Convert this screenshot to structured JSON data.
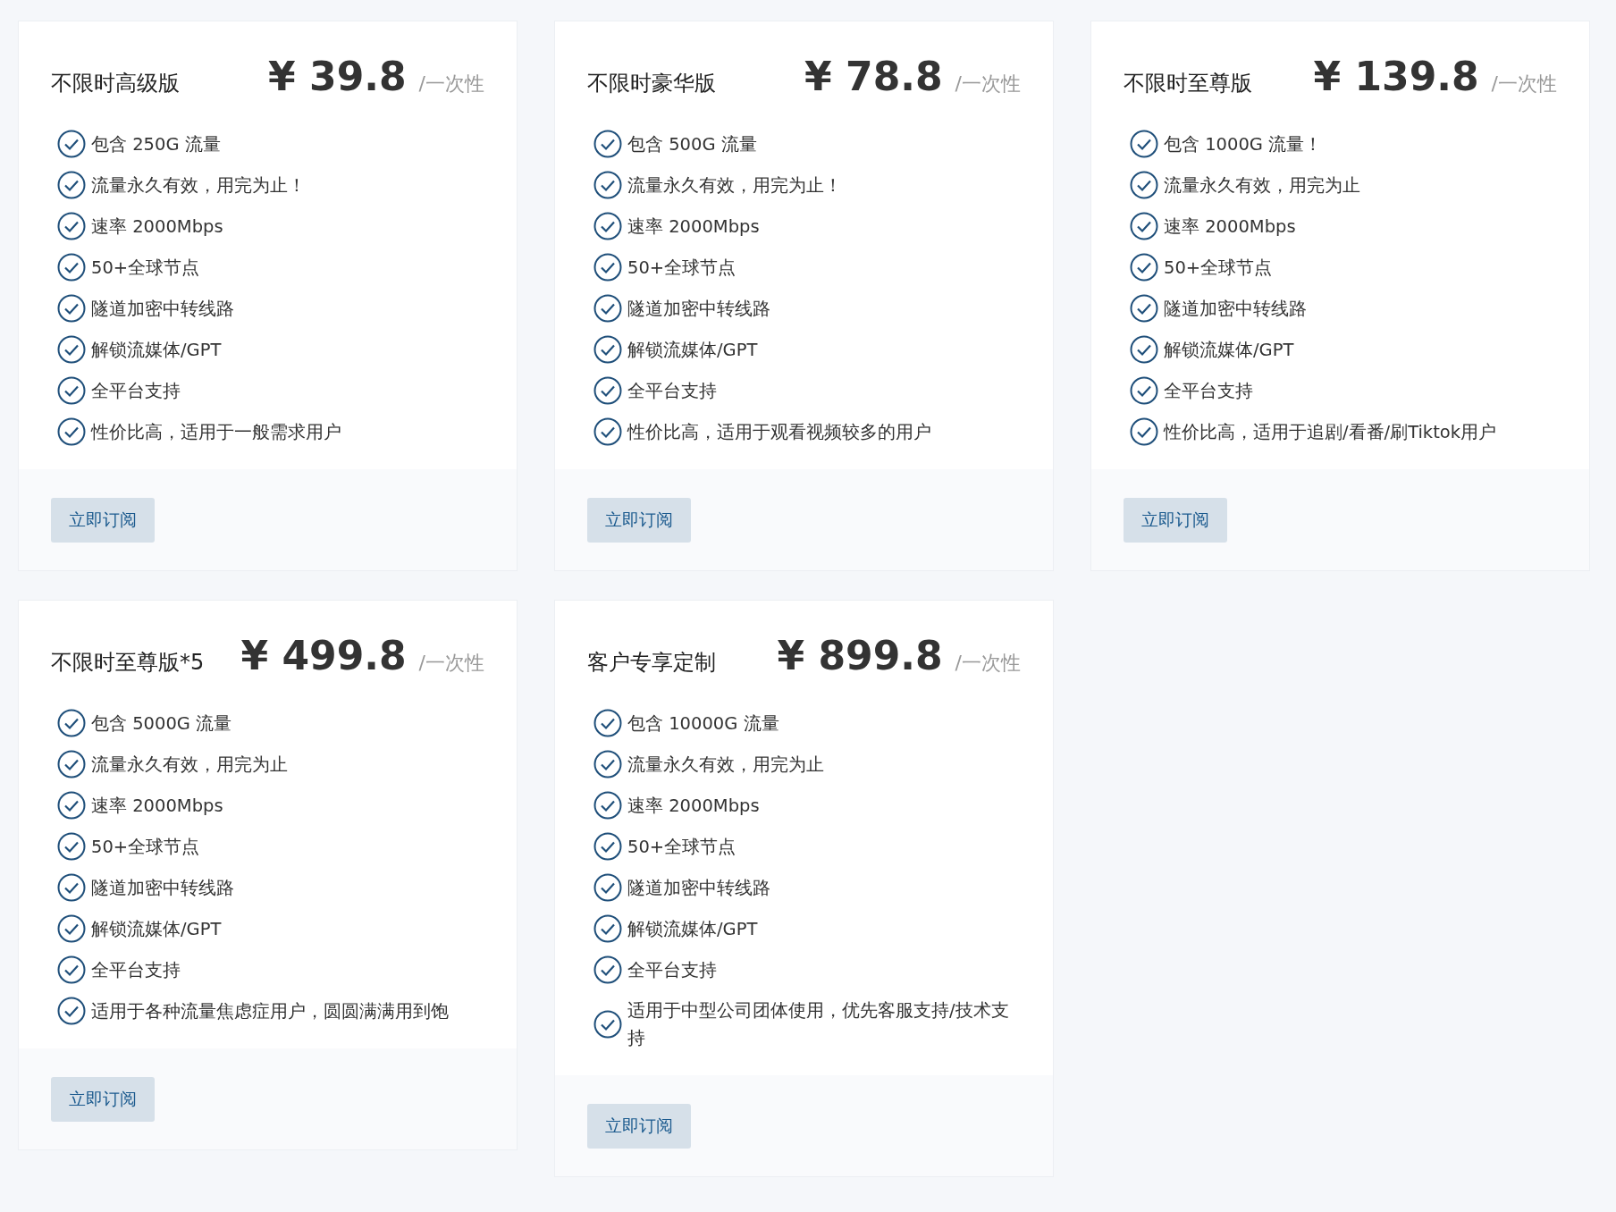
{
  "plans": [
    {
      "title": "不限时高级版",
      "price": "¥ 39.8",
      "unit": "/一次性",
      "features": [
        "包含 250G 流量",
        "流量永久有效，用完为止！",
        "速率 2000Mbps",
        "50+全球节点",
        "隧道加密中转线路",
        "解锁流媒体/GPT",
        "全平台支持",
        "性价比高，适用于一般需求用户"
      ],
      "button": "立即订阅"
    },
    {
      "title": "不限时豪华版",
      "price": "¥ 78.8",
      "unit": "/一次性",
      "features": [
        "包含 500G 流量",
        "流量永久有效，用完为止！",
        "速率 2000Mbps",
        "50+全球节点",
        "隧道加密中转线路",
        "解锁流媒体/GPT",
        "全平台支持",
        "性价比高，适用于观看视频较多的用户"
      ],
      "button": "立即订阅"
    },
    {
      "title": "不限时至尊版",
      "price": "¥ 139.8",
      "unit": "/一次性",
      "features": [
        "包含 1000G 流量！",
        "流量永久有效，用完为止",
        "速率 2000Mbps",
        "50+全球节点",
        "隧道加密中转线路",
        "解锁流媒体/GPT",
        "全平台支持",
        "性价比高，适用于追剧/看番/刷Tiktok用户"
      ],
      "button": "立即订阅"
    },
    {
      "title": "不限时至尊版*5",
      "price": "¥ 499.8",
      "unit": "/一次性",
      "features": [
        "包含 5000G 流量",
        "流量永久有效，用完为止",
        "速率 2000Mbps",
        "50+全球节点",
        "隧道加密中转线路",
        "解锁流媒体/GPT",
        "全平台支持",
        "适用于各种流量焦虑症用户，圆圆满满用到饱"
      ],
      "button": "立即订阅"
    },
    {
      "title": "客户专享定制",
      "price": "¥ 899.8",
      "unit": "/一次性",
      "features": [
        "包含 10000G 流量",
        "流量永久有效，用完为止",
        "速率 2000Mbps",
        "50+全球节点",
        "隧道加密中转线路",
        "解锁流媒体/GPT",
        "全平台支持",
        "适用于中型公司团体使用，优先客服支持/技术支持"
      ],
      "button": "立即订阅"
    }
  ]
}
